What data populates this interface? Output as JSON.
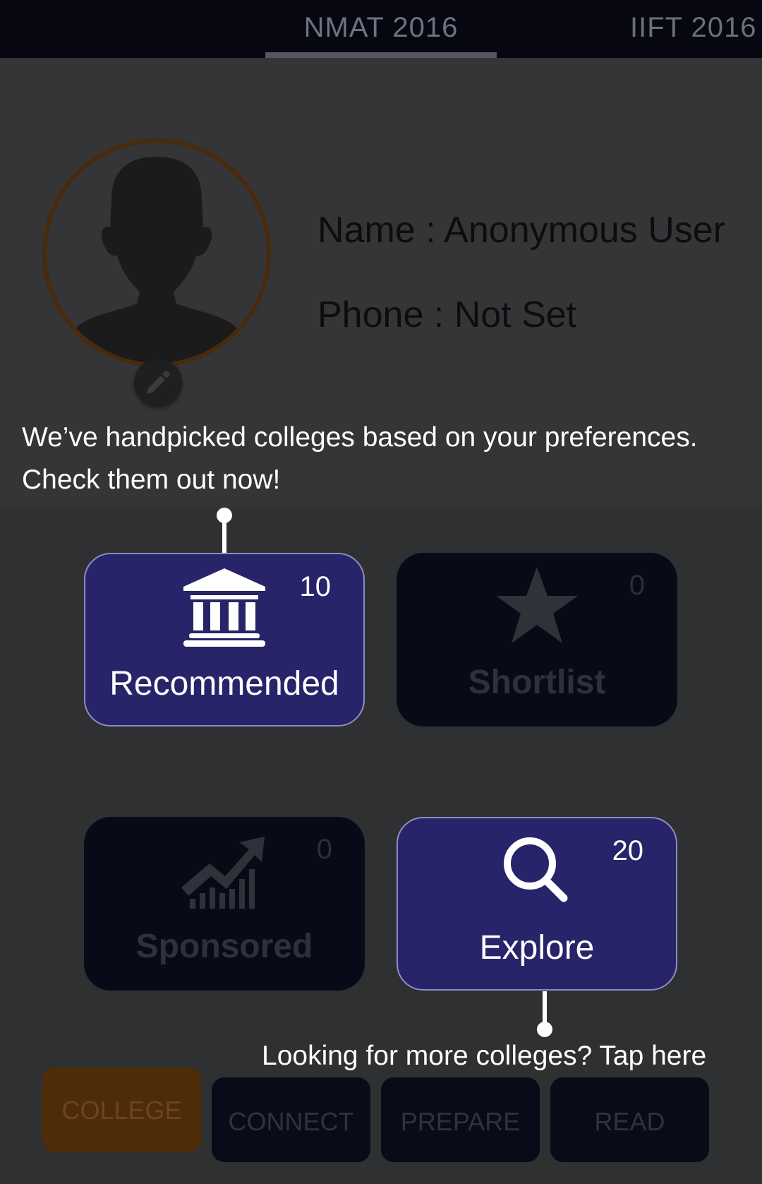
{
  "tabs": [
    {
      "label": "NMAT  2016"
    },
    {
      "label": "IIFT  2016"
    }
  ],
  "profile": {
    "name_line": "Name : Anonymous User",
    "phone_line": "Phone : Not Set"
  },
  "tooltips": {
    "recommended_line1": "We’ve handpicked colleges based on your preferences.",
    "recommended_line2": "Check them out now!",
    "explore": "Looking for more colleges? Tap here"
  },
  "cards": {
    "recommended": {
      "label": "Recommended",
      "count": "10",
      "icon": "bank-icon"
    },
    "shortlist": {
      "label": "Shortlist",
      "count": "0",
      "icon": "star-icon"
    },
    "sponsored": {
      "label": "Sponsored",
      "count": "0",
      "icon": "trending-up-icon"
    },
    "explore": {
      "label": "Explore",
      "count": "20",
      "icon": "search-icon"
    }
  },
  "bottom_nav": {
    "college": "COLLEGE",
    "connect": "CONNECT",
    "prepare": "PREPARE",
    "read": "READ"
  },
  "colors": {
    "highlight_card": "#27246a",
    "dim_card": "#080a17",
    "college_tab": "#4e2c08",
    "overlay": "#2f3032"
  }
}
